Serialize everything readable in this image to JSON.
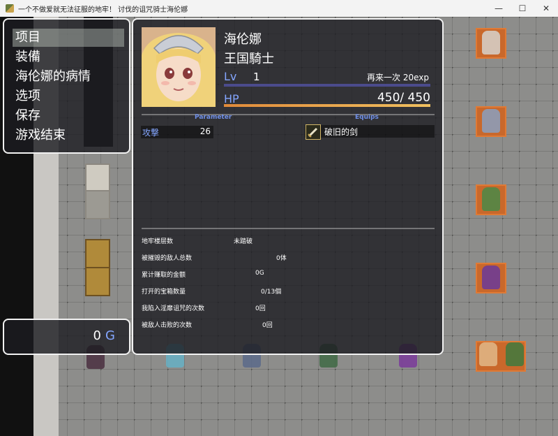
{
  "window": {
    "title": "一个不做爱就无法征服的地牢！ 讨伐的诅咒骑士海伦娜",
    "controls": {
      "minimize": "—",
      "maximize": "☐",
      "close": "✕"
    }
  },
  "menu": {
    "items": [
      {
        "label": "项目",
        "selected": true
      },
      {
        "label": "装備",
        "selected": false
      },
      {
        "label": "海伦娜的病情",
        "selected": false
      },
      {
        "label": "选项",
        "selected": false
      },
      {
        "label": "保存",
        "selected": false
      },
      {
        "label": "游戏结束",
        "selected": false
      }
    ]
  },
  "gold": {
    "value": "0",
    "unit": "G"
  },
  "actor": {
    "name": "海伦娜",
    "class": "王国騎士",
    "level_label": "Lv",
    "level": "1",
    "exp_text": "再来一次 20exp",
    "hp_label": "HP",
    "hp_text": "450/ 450",
    "hp_fraction": 1.0
  },
  "sections": {
    "parameter": "Parameter",
    "equips": "Equips"
  },
  "params": [
    {
      "name": "攻撃",
      "value": "26"
    }
  ],
  "equips": [
    {
      "name": "破旧的剑",
      "icon": "sword-icon"
    }
  ],
  "stats": [
    {
      "label": "地牢楼层数",
      "value": "未踏破"
    },
    {
      "label": "被摧毁的敌人总数",
      "value": "0体"
    },
    {
      "label": "累计赚取的金额",
      "value": "0G"
    },
    {
      "label": "打开的宝箱数量",
      "value": "0/13個"
    },
    {
      "label": "我陷入淫靡诅咒的次数",
      "value": "0回"
    },
    {
      "label": "被敌人击败的次数",
      "value": "0回"
    }
  ],
  "colors": {
    "accent": "#84a6ff",
    "hp": "#e8a04c",
    "window_border": "#f2f2f2"
  }
}
